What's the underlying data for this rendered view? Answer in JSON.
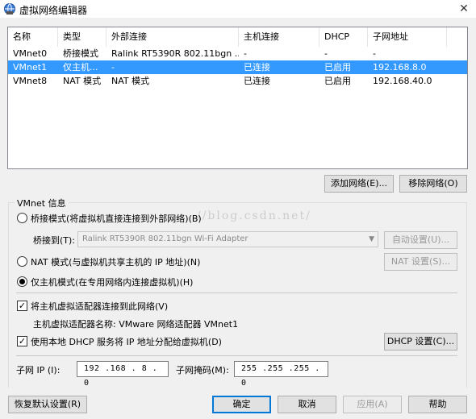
{
  "window": {
    "title": "虚拟网络编辑器",
    "close_label": "✕"
  },
  "table": {
    "columns": [
      "名称",
      "类型",
      "外部连接",
      "主机连接",
      "DHCP",
      "子网地址"
    ],
    "rows": [
      [
        "VMnet0",
        "桥接模式",
        "Ralink RT5390R 802.11bgn ...",
        "-",
        "-",
        "-"
      ],
      [
        "VMnet1",
        "仅主机...",
        "-",
        "已连接",
        "已启用",
        "192.168.8.0"
      ],
      [
        "VMnet8",
        "NAT 模式",
        "NAT 模式",
        "已连接",
        "已启用",
        "192.168.40.0"
      ]
    ],
    "selected_row": 1
  },
  "table_buttons": {
    "add": "添加网络(E)...",
    "remove": "移除网络(O)"
  },
  "vmnet_info": {
    "group_title": "VMnet 信息",
    "bridged_label": "桥接模式(将虚拟机直接连接到外部网络)(B)",
    "bridged_to_label": "桥接到(T):",
    "bridged_to_value": "Ralink RT5390R 802.11bgn Wi-Fi Adapter",
    "auto_settings": "自动设置(U)...",
    "nat_label": "NAT 模式(与虚拟机共享主机的 IP 地址)(N)",
    "nat_settings": "NAT 设置(S)...",
    "hostonly_label": "仅主机模式(在专用网络内连接虚拟机)(H)",
    "selected_mode": "hostonly",
    "connect_adapter_label": "将主机虚拟适配器连接到此网络(V)",
    "connect_adapter_checked": true,
    "adapter_name_label": "主机虚拟适配器名称: VMware 网络适配器 VMnet1",
    "dhcp_label": "使用本地 DHCP 服务将 IP 地址分配给虚拟机(D)",
    "dhcp_checked": true,
    "dhcp_settings": "DHCP 设置(C)...",
    "subnet_ip_label": "子网 IP (I):",
    "subnet_ip": "192 .168 . 8 . 0",
    "subnet_mask_label": "子网掩码(M):",
    "subnet_mask": "255 .255 .255 . 0"
  },
  "footer": {
    "restore": "恢复默认设置(R)",
    "ok": "确定",
    "cancel": "取消",
    "apply": "应用(A)",
    "help": "帮助"
  },
  "watermark": "//blog.csdn.net/"
}
